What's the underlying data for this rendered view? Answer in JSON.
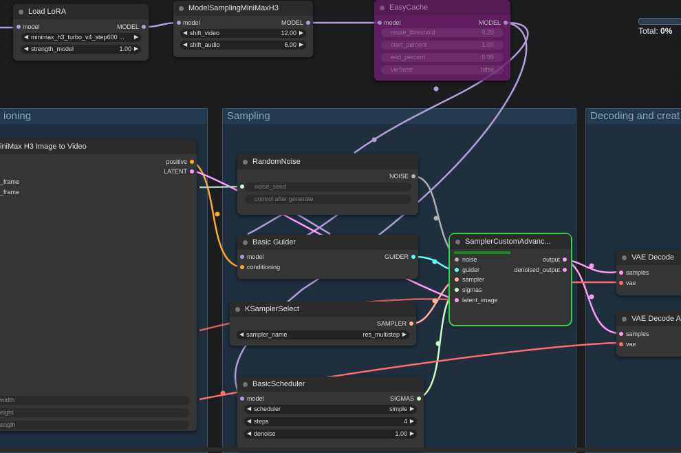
{
  "groups": {
    "conditioning": "ioning",
    "sampling": "Sampling",
    "decoding": "Decoding and creat"
  },
  "load_lora": {
    "title": "Load LoRA",
    "in": "model",
    "out": "MODEL",
    "lora_name": "minimax_h3_turbo_v4_step600 ...",
    "strength_label": "strength_model",
    "strength_value": "1.00"
  },
  "model_sampling": {
    "title": "ModelSamplingMiniMaxH3",
    "in": "model",
    "out": "MODEL",
    "shift_video_label": "shift_video",
    "shift_video_value": "12.00",
    "shift_audio_label": "shift_audio",
    "shift_audio_value": "6.00"
  },
  "easycache": {
    "title": "EasyCache",
    "in": "model",
    "out": "MODEL",
    "reuse_label": "reuse_threshold",
    "reuse_value": "0.20",
    "start_label": "start_percent",
    "start_value": "1.00",
    "end_label": "end_percent",
    "end_value": "0.95",
    "verbose_label": "verbose",
    "verbose_value": "false"
  },
  "progress": {
    "label": "Total:",
    "value": "0%",
    "fraction": 0
  },
  "i2v": {
    "title": "iniMax H3 Image to Video",
    "out_positive": "positive",
    "out_latent": "LATENT",
    "in_first": "_frame",
    "in_last": "_frame",
    "w_width": "width",
    "w_height": "eight",
    "w_length": "ength"
  },
  "random_noise": {
    "title": "RandomNoise",
    "out": "NOISE",
    "seed_label": "noise_seed",
    "control_label": "control after generate"
  },
  "basic_guider": {
    "title": "Basic Guider",
    "in_model": "model",
    "in_cond": "conditioning",
    "out": "GUIDER"
  },
  "ksampler_select": {
    "title": "KSamplerSelect",
    "out": "SAMPLER",
    "sampler_label": "sampler_name",
    "sampler_value": "res_multistep"
  },
  "basic_scheduler": {
    "title": "BasicScheduler",
    "in_model": "model",
    "out": "SIGMAS",
    "scheduler_label": "scheduler",
    "scheduler_value": "simple",
    "steps_label": "steps",
    "steps_value": "4",
    "denoise_label": "denoise",
    "denoise_value": "1.00"
  },
  "sampler_custom": {
    "title": "SamplerCustomAdvanc...",
    "in_noise": "noise",
    "in_guider": "guider",
    "in_sampler": "sampler",
    "in_sigmas": "sigmas",
    "in_latent": "latent_image",
    "out_output": "output",
    "out_denoised": "denoised_output"
  },
  "vae_decode": {
    "title": "VAE Decode",
    "in_samples": "samples",
    "in_vae": "vae"
  },
  "vae_decode_audio": {
    "title": "VAE Decode Au",
    "in_samples": "samples",
    "in_vae": "vae"
  },
  "colors": {
    "model": "#b39ddb",
    "latent": "#ff9cf9",
    "conditioning": "#ffa931",
    "noise": "#b0b0b0",
    "guider": "#66ffff",
    "sampler": "#ffb3a0",
    "sigmas": "#c8ffc8",
    "vae": "#ff6e6e",
    "selected": "#35d24a",
    "bypass": "#6b1f6b"
  }
}
